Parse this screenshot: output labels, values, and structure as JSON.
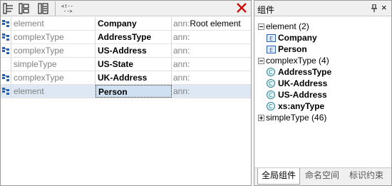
{
  "rows": [
    {
      "kind": "element",
      "name": "Company",
      "ann_label": "ann:",
      "ann_value": "Root element"
    },
    {
      "kind": "complexType",
      "name": "AddressType",
      "ann_label": "ann:",
      "ann_value": ""
    },
    {
      "kind": "complexType",
      "name": "US-Address",
      "ann_label": "ann:",
      "ann_value": ""
    },
    {
      "kind": "simpleType",
      "name": "US-State",
      "ann_label": "ann:",
      "ann_value": ""
    },
    {
      "kind": "complexType",
      "name": "UK-Address",
      "ann_label": "ann:",
      "ann_value": ""
    },
    {
      "kind": "element",
      "name": "Person",
      "ann_label": "ann:",
      "ann_value": ""
    }
  ],
  "panel": {
    "title": "组件",
    "close_glyph": "×",
    "tree": {
      "element_group": "element (2)",
      "element_items": [
        "Company",
        "Person"
      ],
      "complex_group": "complexType (4)",
      "complex_items": [
        "AddressType",
        "UK-Address",
        "US-Address",
        "xs:anyType"
      ],
      "simple_group": "simpleType (46)"
    },
    "tabs": [
      "全局组件",
      "命名空间",
      "标识约束"
    ]
  },
  "colors": {
    "icon_blue": "#2a5fb0",
    "close_red": "#cc1111",
    "icon_teal": "#2a7f8f",
    "selected_row": "#dde8f4"
  },
  "icons": {
    "row_icon": "component-link-icon",
    "element_icon": "element-icon",
    "complex_icon": "complex-type-icon"
  }
}
